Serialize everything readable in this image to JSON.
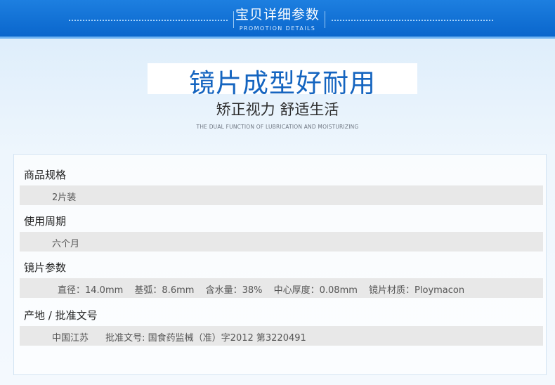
{
  "banner": {
    "title": "宝贝详细参数",
    "subtitle": "PROMOTION DETAILS"
  },
  "hero": {
    "headline": "镜片成型好耐用",
    "subheadline": "矫正视力 舒适生活",
    "tagline": "THE DUAL FUNCTION OF LUBRICATION AND MOISTURIZING"
  },
  "specs": {
    "spec": {
      "label": "商品规格",
      "value": "2片装"
    },
    "period": {
      "label": "使用周期",
      "value": "六个月"
    },
    "lens": {
      "label": "镜片参数",
      "diameter": "直径：14.0mm",
      "base_curve": "基弧：8.6mm",
      "water": "含水量：38%",
      "thickness": "中心厚度：0.08mm",
      "material": "镜片材质：Ploymacon"
    },
    "origin": {
      "label": "产地 / 批准文号",
      "place": "中国江苏",
      "approval": "批准文号: 国食药监械（准）字2012 第3220491"
    }
  },
  "colors": {
    "banner_blue": "#0a66cc",
    "headline_blue": "#1565c0",
    "value_bar": "#e8e8e8"
  }
}
